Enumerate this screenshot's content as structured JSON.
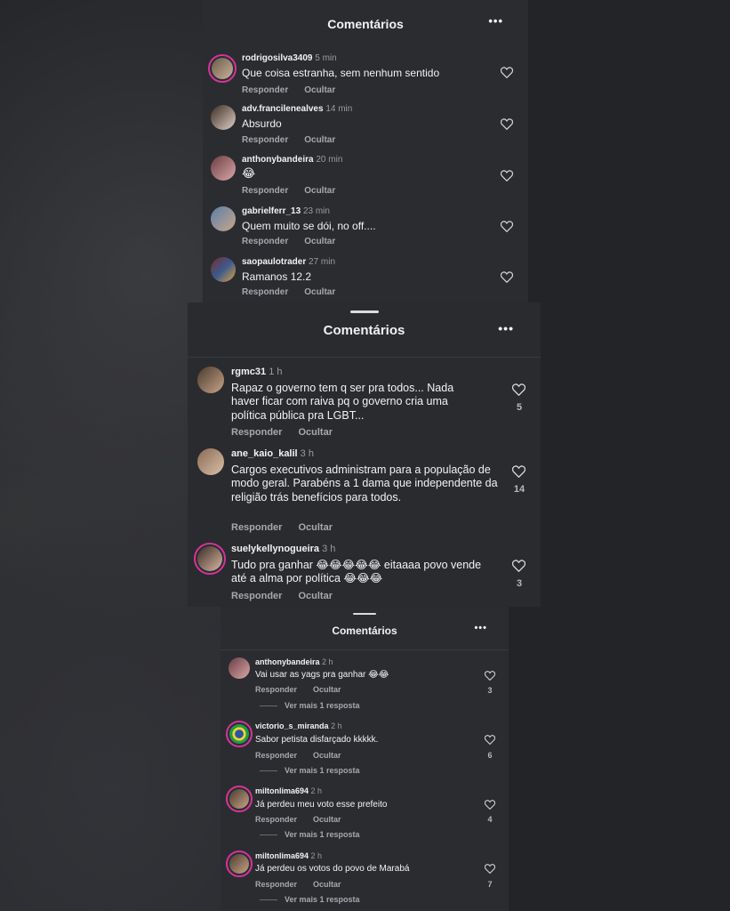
{
  "panel1": {
    "title": "Comentários",
    "menu": "•••",
    "comments": [
      {
        "user": "rodrigosilva3409",
        "time": "5 min",
        "text": "Que coisa estranha, sem nenhum sentido",
        "reply": "Responder",
        "hide": "Ocultar"
      },
      {
        "user": "adv.francilenealves",
        "time": "14 min",
        "text": "Absurdo",
        "reply": "Responder",
        "hide": "Ocultar"
      },
      {
        "user": "anthonybandeira",
        "time": "20 min",
        "text": "😂",
        "reply": "Responder",
        "hide": "Ocultar"
      },
      {
        "user": "gabrielferr_13",
        "time": "23 min",
        "text": "Quem muito se dói,  no off....",
        "reply": "Responder",
        "hide": "Ocultar"
      },
      {
        "user": "saopaulotrader",
        "time": "27 min",
        "text": "Ramanos 12.2",
        "reply": "Responder",
        "hide": "Ocultar"
      }
    ]
  },
  "panel2": {
    "title": "Comentários",
    "menu": "•••",
    "comments": [
      {
        "user": "rgmc31",
        "time": "1 h",
        "text": "Rapaz o governo tem q ser pra todos... Nada haver ficar com raiva pq o governo cria uma política pública pra LGBT...",
        "reply": "Responder",
        "hide": "Ocultar",
        "likes": "5"
      },
      {
        "user": "ane_kaio_kalil",
        "time": "3 h",
        "text": "Cargos executivos administram para a população de modo geral. Parabéns a 1 dama que independente da religião trás benefícios para todos.",
        "reply": "Responder",
        "hide": "Ocultar",
        "likes": "14"
      },
      {
        "user": "suelykellynogueira",
        "time": "3 h",
        "text": "Tudo pra ganhar 😂😂😂😂😂 eitaaaa povo vende até a alma por política 😂😂😂",
        "reply": "Responder",
        "hide": "Ocultar",
        "likes": "3"
      }
    ]
  },
  "panel3": {
    "title": "Comentários",
    "menu": "•••",
    "comments": [
      {
        "user": "anthonybandeira",
        "time": "2 h",
        "text": "Vai usar as yags pra ganhar 😂😂",
        "reply": "Responder",
        "hide": "Ocultar",
        "likes": "3",
        "more": "Ver mais 1 resposta"
      },
      {
        "user": "victorio_s_miranda",
        "time": "2 h",
        "text": "Sabor petista disfarçado kkkkk.",
        "reply": "Responder",
        "hide": "Ocultar",
        "likes": "6",
        "more": "Ver mais 1 resposta"
      },
      {
        "user": "miltonlima694",
        "time": "2 h",
        "text": "Já perdeu meu voto esse prefeito",
        "reply": "Responder",
        "hide": "Ocultar",
        "likes": "4",
        "more": "Ver mais 1 resposta"
      },
      {
        "user": "miltonlima694",
        "time": "2 h",
        "text": "Já perdeu os votos do povo de Marabá",
        "reply": "Responder",
        "hide": "Ocultar",
        "likes": "7",
        "more": "Ver mais 1 resposta"
      }
    ]
  },
  "icons": {
    "heart": "heart-outline-icon",
    "menu": "more-horizontal-icon"
  },
  "colors": {
    "background": "#2a2b2f",
    "story_ring": "#d6339b",
    "muted_text": "#a7a7ad"
  }
}
